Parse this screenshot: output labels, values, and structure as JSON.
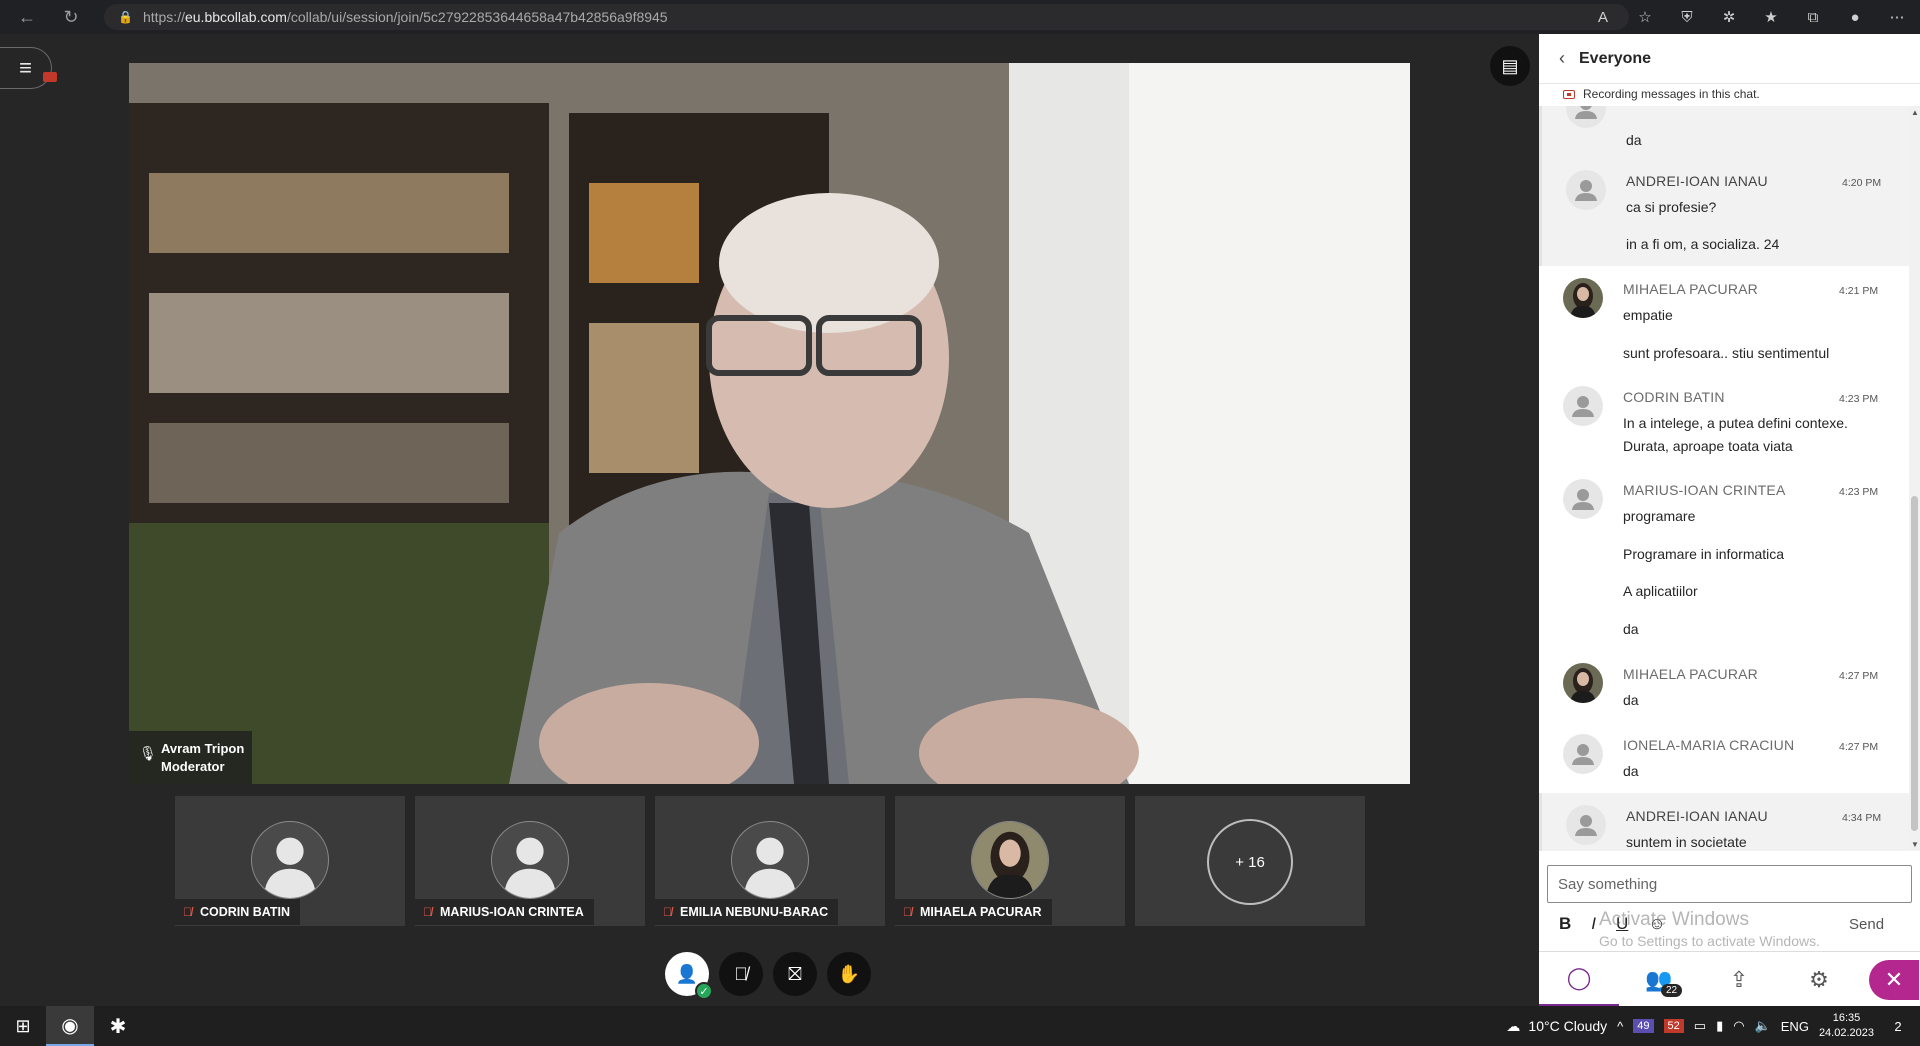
{
  "browser": {
    "url_prefix": "https://",
    "url_domain": "eu.bbcollab.com",
    "url_path": "/collab/ui/session/join/5c27922853644658a47b42856a9f8945"
  },
  "speaker": {
    "name": "Avram Tripon",
    "role": "Moderator"
  },
  "tiles": [
    {
      "name": "CODRIN BATIN",
      "photo": false
    },
    {
      "name": "MARIUS-IOAN CRINTEA",
      "photo": false
    },
    {
      "name": "EMILIA NEBUNU-BARAC",
      "photo": false
    },
    {
      "name": "MIHAELA PACURAR",
      "photo": true
    }
  ],
  "more_participants": "+ 16",
  "chat": {
    "title": "Everyone",
    "recording_note": "Recording messages in this chat.",
    "messages": [
      {
        "name": "",
        "time": "",
        "lines": [
          "da"
        ],
        "highlight": true
      },
      {
        "name": "ANDREI-IOAN IANAU",
        "time": "4:20 PM",
        "lines": [
          "ca si profesie?",
          "in a fi om, a socializa. 24"
        ],
        "highlight": true
      },
      {
        "name": "MIHAELA PACURAR",
        "time": "4:21 PM",
        "lines": [
          "empatie",
          "sunt profesoara.. stiu sentimentul"
        ],
        "highlight": false
      },
      {
        "name": "CODRIN BATIN",
        "time": "4:23 PM",
        "lines": [
          "In a intelege, a putea defini contexe.",
          "Durata, aproape toata viata"
        ],
        "highlight": false
      },
      {
        "name": "MARIUS-IOAN CRINTEA",
        "time": "4:23 PM",
        "lines": [
          "programare",
          "Programare in informatica",
          "A aplicatiilor",
          "da"
        ],
        "highlight": false
      },
      {
        "name": "MIHAELA PACURAR",
        "time": "4:27 PM",
        "lines": [
          "da"
        ],
        "highlight": false
      },
      {
        "name": "IONELA-MARIA CRACIUN",
        "time": "4:27 PM",
        "lines": [
          "da"
        ],
        "highlight": false
      },
      {
        "name": "ANDREI-IOAN IANAU",
        "time": "4:34 PM",
        "lines": [
          "suntem in societate"
        ],
        "highlight": true
      }
    ],
    "input_placeholder": "Say something",
    "send_label": "Send",
    "participants_count": "22"
  },
  "watermark": {
    "line1": "Activate Windows",
    "line2": "Go to Settings to activate Windows."
  },
  "taskbar": {
    "weather": "10°C  Cloudy",
    "badge_a": "49",
    "badge_b": "52",
    "lang": "ENG",
    "time": "16:35",
    "date": "24.02.2023",
    "notif_count": "2"
  }
}
